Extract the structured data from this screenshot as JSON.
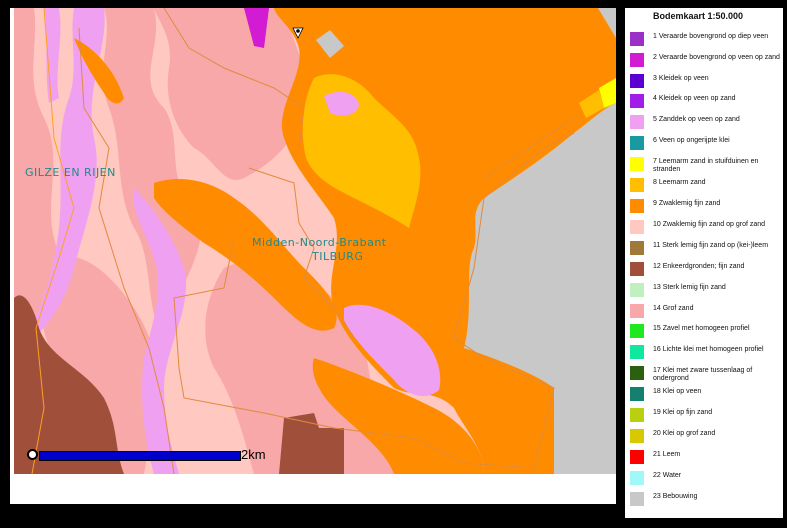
{
  "map": {
    "places": {
      "gilze": "GILZE EN RIJEN",
      "region": "Midden-Noord-Brabant",
      "tilburg": "TILBURG"
    },
    "scale_label": "2km"
  },
  "legend": {
    "title": "Bodemkaart 1:50.000",
    "items": [
      {
        "label": "1 Veraarde bovengrond op diep veen",
        "color": "#9b30c8"
      },
      {
        "label": "2 Veraarde bovengrond op veen op zand",
        "color": "#d21bd2"
      },
      {
        "label": "3 Kleidek op veen",
        "color": "#5a00d2"
      },
      {
        "label": "4 Kleidek op veen op zand",
        "color": "#a01ee8"
      },
      {
        "label": "5 Zanddek op veen op zand",
        "color": "#f0a0f0"
      },
      {
        "label": "6 Veen op ongerijpte klei",
        "color": "#1a9aa0"
      },
      {
        "label": "7 Leemarm zand in stuifduinen en stranden",
        "color": "#ffff00"
      },
      {
        "label": "8 Leemarm zand",
        "color": "#ffbf00"
      },
      {
        "label": "9 Zwaklemig fijn zand",
        "color": "#ff8c00"
      },
      {
        "label": "10 Zwaklemig fijn zand op grof zand",
        "color": "#ffc8c0"
      },
      {
        "label": "11 Sterk lemig fijn zand op (kei-)leem",
        "color": "#a07838"
      },
      {
        "label": "12 Enkeerdgronden; fijn zand",
        "color": "#a0503a"
      },
      {
        "label": "13 Sterk lemig fijn zand",
        "color": "#c0f0c0"
      },
      {
        "label": "14 Grof zand",
        "color": "#f8a8a8"
      },
      {
        "label": "15 Zavel met homogeen profiel",
        "color": "#20e820"
      },
      {
        "label": "16 Lichte klei met homogeen profiel",
        "color": "#10e8a0"
      },
      {
        "label": "17 Klei met zware tussenlaag of ondergrond",
        "color": "#2a6010"
      },
      {
        "label": "18 Klei op veen",
        "color": "#148070"
      },
      {
        "label": "19 Klei op fijn zand",
        "color": "#b8d010"
      },
      {
        "label": "20 Klei op grof zand",
        "color": "#d8c800"
      },
      {
        "label": "21 Leem",
        "color": "#ff0000"
      },
      {
        "label": "22 Water",
        "color": "#a0f8f8"
      },
      {
        "label": "23 Bebouwing",
        "color": "#c8c8c8"
      }
    ]
  }
}
